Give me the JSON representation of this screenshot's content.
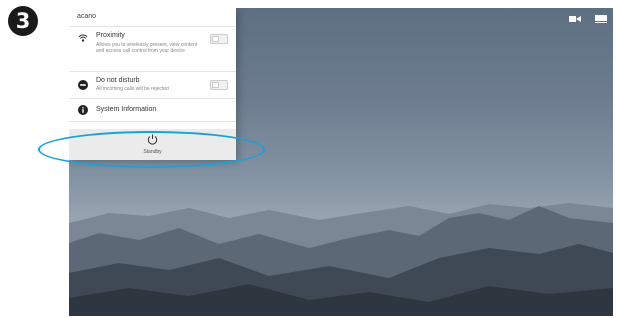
{
  "step": {
    "number": "3"
  },
  "panel": {
    "title": "acano",
    "items": [
      {
        "label": "Proximity",
        "description": "Allows you to wirelessly present, view content and access call control from your device",
        "toggle_on": false
      },
      {
        "label": "Do not disturb",
        "description": "All incoming calls will be rejected",
        "toggle_on": false
      },
      {
        "label": "System Information"
      }
    ],
    "standby_label": "Standby"
  },
  "top_icons": [
    "camera-icon",
    "screen-icon"
  ],
  "colors": {
    "highlight": "#1aa1d8",
    "step_badge": "#1a1a1a"
  }
}
